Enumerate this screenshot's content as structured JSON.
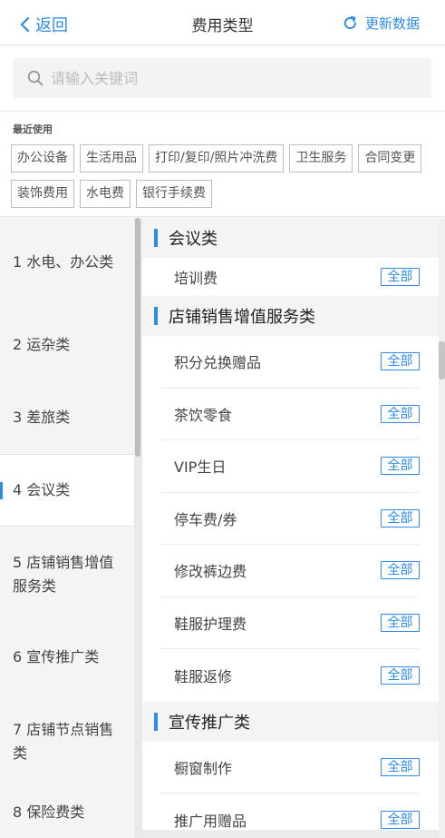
{
  "header": {
    "back_label": "返回",
    "title": "费用类型",
    "refresh_label": "更新数据"
  },
  "search": {
    "placeholder": "请输入关键词",
    "value": ""
  },
  "recent": {
    "title": "最近使用",
    "tags": [
      "办公设备",
      "生活用品",
      "打印/复印/照片冲洗费",
      "卫生服务",
      "合同变更",
      "装饰费用",
      "水电费",
      "银行手续费"
    ]
  },
  "nav": {
    "items": [
      {
        "label": "1 水电、办公类"
      },
      {
        "label": "2 运杂类"
      },
      {
        "label": "3 差旅类"
      },
      {
        "label": "4 会议类",
        "active": true
      },
      {
        "label": "5 店铺销售增值服务类"
      },
      {
        "label": "6 宣传推广类"
      },
      {
        "label": "7 店铺节点销售类"
      },
      {
        "label": "8 保险费类"
      }
    ]
  },
  "list": {
    "all_label": "全部",
    "sections": [
      {
        "title": "会议类",
        "items": [
          "培训费"
        ]
      },
      {
        "title": "店铺销售增值服务类",
        "items": [
          "积分兑换赠品",
          "茶饮零食",
          "VIP生日",
          "停车费/券",
          "修改裤边费",
          "鞋服护理费",
          "鞋服返修"
        ]
      },
      {
        "title": "宣传推广类",
        "items": [
          "橱窗制作",
          "推广用赠品"
        ]
      }
    ]
  },
  "colors": {
    "accent": "#2f8be6"
  }
}
